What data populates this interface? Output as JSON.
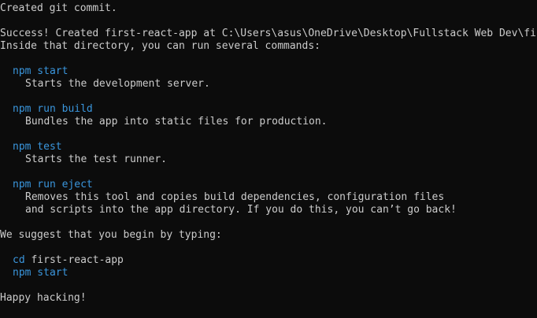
{
  "terminal": {
    "created_commit": "Created git commit.",
    "success_line": "Success! Created first-react-app at C:\\Users\\asus\\OneDrive\\Desktop\\Fullstack Web Dev\\fi",
    "inside_dir": "Inside that directory, you can run several commands:",
    "commands": [
      {
        "cmd": "npm start",
        "desc": [
          "Starts the development server."
        ]
      },
      {
        "cmd": "npm run build",
        "desc": [
          "Bundles the app into static files for production."
        ]
      },
      {
        "cmd": "npm test",
        "desc": [
          "Starts the test runner."
        ]
      },
      {
        "cmd": "npm run eject",
        "desc": [
          "Removes this tool and copies build dependencies, configuration files",
          "and scripts into the app directory. If you do this, you can’t go back!"
        ]
      }
    ],
    "suggest": "We suggest that you begin by typing:",
    "suggest_cd": "cd",
    "suggest_dir": " first-react-app",
    "suggest_start": "npm start",
    "happy": "Happy hacking!",
    "colors": {
      "background": "#0c0c0c",
      "text": "#cccccc",
      "command": "#3a96dd"
    }
  }
}
